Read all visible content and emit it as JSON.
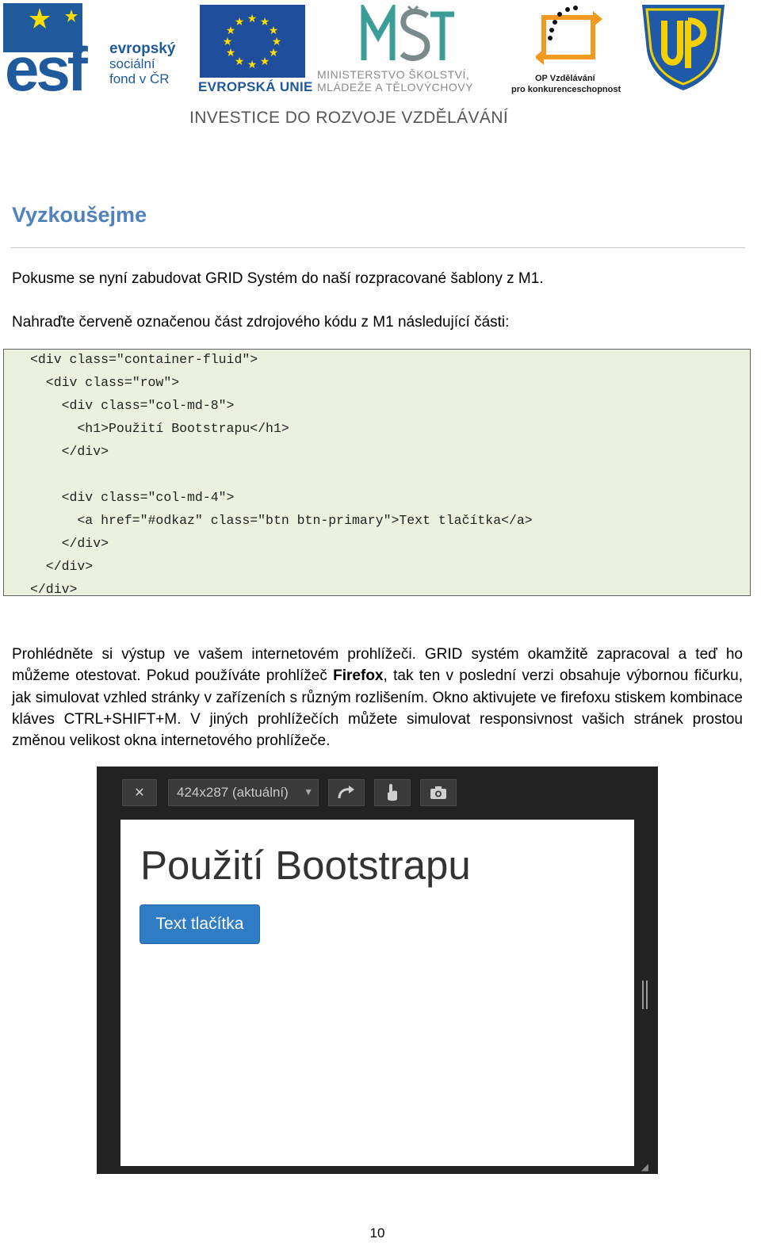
{
  "header": {
    "esf": {
      "lines": [
        "evropský",
        "sociální",
        "fond v ČR"
      ],
      "mark": "esf"
    },
    "eu": {
      "label": "EVROPSKÁ UNIE"
    },
    "msmt": {
      "lines": [
        "MINISTERSTVO ŠKOLSTVÍ,",
        "MLÁDEŽE A TĚLOVÝCHOVY"
      ]
    },
    "op": {
      "lines": [
        "OP Vzdělávání",
        "pro konkurenceschopnost"
      ]
    },
    "investice": "INVESTICE DO ROZVOJE VZDĚLÁVÁNÍ",
    "colors": {
      "esf_blue": "#1f5a9c",
      "eu_blue": "#1f4e9d",
      "eu_star": "#ffdd00",
      "msmt_teal": "#3a9d96",
      "op_orange": "#f29a1f",
      "upol_blue": "#1e5aa8",
      "upol_gold": "#f5d000"
    }
  },
  "heading": "Vyzkoušejme",
  "intro": [
    "Pokusme se nyní zabudovat GRID Systém do naší rozpracované šablony z M1.",
    "Nahraďte červeně označenou část zdrojového kódu z M1 následující části:"
  ],
  "code": [
    "<div class=\"container-fluid\">",
    "  <div class=\"row\">",
    "    <div class=\"col-md-8\">",
    "      <h1>Použití Bootstrapu</h1>",
    "    </div>",
    "",
    "    <div class=\"col-md-4\">",
    "      <a href=\"#odkaz\" class=\"btn btn-primary\">Text tlačítka</a>",
    "    </div>",
    "  </div>",
    "</div>"
  ],
  "body": {
    "text_1": "Prohlédněte si výstup ve vašem internetovém prohlížeči. GRID systém okamžitě zapracoval a teď ho můžeme otestovat. Pokud používáte prohlížeč ",
    "bold": "Firefox",
    "text_2": ", tak ten v poslední verzi obsahuje výbornou fičurku, jak simulovat vzhled stránky v zařízeních s různým rozlišením. Okno aktivujete ve firefoxu stiskem kombinace kláves CTRL+SHIFT+M. V jiných prohlížečích můžete simulovat responsivnost vašich stránek prostou změnou velikost okna internetového prohlížeče."
  },
  "screenshot": {
    "toolbar": {
      "close_icon": "close-icon",
      "size_label": "424x287 (aktuální)",
      "rotate_icon": "rotate-icon",
      "touch_icon": "touch-icon",
      "camera_icon": "camera-icon"
    },
    "title": "Použití Bootstrapu",
    "button_label": "Text tlačítka",
    "colors": {
      "frame": "#222222",
      "button": "#2f7dc4"
    }
  },
  "page_number": "10"
}
